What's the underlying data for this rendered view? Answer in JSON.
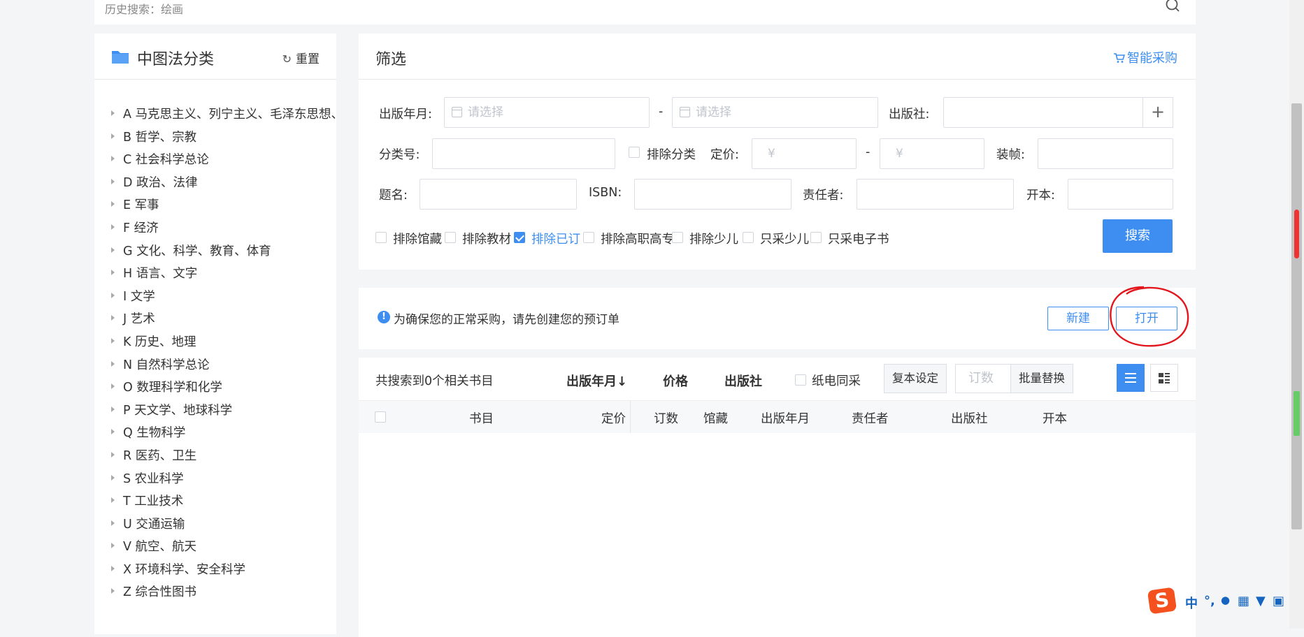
{
  "top_search": {
    "history_label": "历史搜索：绘画"
  },
  "category_panel": {
    "title": "中图法分类",
    "reset_label": "重置",
    "items": [
      "A 马克思主义、列宁主义、毛泽东思想、",
      "B 哲学、宗教",
      "C 社会科学总论",
      "D 政治、法律",
      "E 军事",
      "F 经济",
      "G 文化、科学、教育、体育",
      "H 语言、文字",
      "I 文学",
      "J 艺术",
      "K 历史、地理",
      "N 自然科学总论",
      "O 数理科学和化学",
      "P 天文学、地球科学",
      "Q 生物科学",
      "R 医药、卫生",
      "S 农业科学",
      "T 工业技术",
      "U 交通运输",
      "V 航空、航天",
      "X 环境科学、安全科学",
      "Z 综合性图书"
    ]
  },
  "filter": {
    "title": "筛选",
    "smart_purchase": "智能采购",
    "pub_date_label": "出版年月:",
    "date_placeholder": "请选择",
    "dash": "-",
    "publisher_label": "出版社:",
    "class_no_label": "分类号:",
    "exclude_class_label": "排除分类",
    "price_label": "定价:",
    "currency": "¥",
    "binding_label": "装帧:",
    "title_label": "题名:",
    "isbn_label": "ISBN:",
    "author_label": "责任者:",
    "format_label": "开本:",
    "checkboxes": [
      {
        "label": "排除馆藏",
        "checked": false
      },
      {
        "label": "排除教材",
        "checked": false
      },
      {
        "label": "排除已订",
        "checked": true
      },
      {
        "label": "排除高职高专",
        "checked": false
      },
      {
        "label": "排除少儿",
        "checked": false
      },
      {
        "label": "只采少儿",
        "checked": false
      },
      {
        "label": "只采电子书",
        "checked": false
      }
    ],
    "search_button": "搜索"
  },
  "notice": {
    "message": "为确保您的正常采购，请先创建您的预订单",
    "new_button": "新建",
    "open_button": "打开"
  },
  "results": {
    "count_text": "共搜索到0个相关书目",
    "sort_pub_date": "出版年月",
    "sort_price": "价格",
    "sort_publisher": "出版社",
    "paper_ebook_label": "纸电同采",
    "copy_settings": "复本设定",
    "order_placeholder": "订数",
    "batch_replace": "批量替换",
    "columns": [
      "书目",
      "定价",
      "订数",
      "馆藏",
      "出版年月",
      "责任者",
      "出版社",
      "开本"
    ]
  },
  "ime": {
    "lang": "中",
    "punct": "°,",
    "mic": "🎤"
  },
  "colors": {
    "accent": "#3d8ef0",
    "annotation": "#e3161d"
  }
}
